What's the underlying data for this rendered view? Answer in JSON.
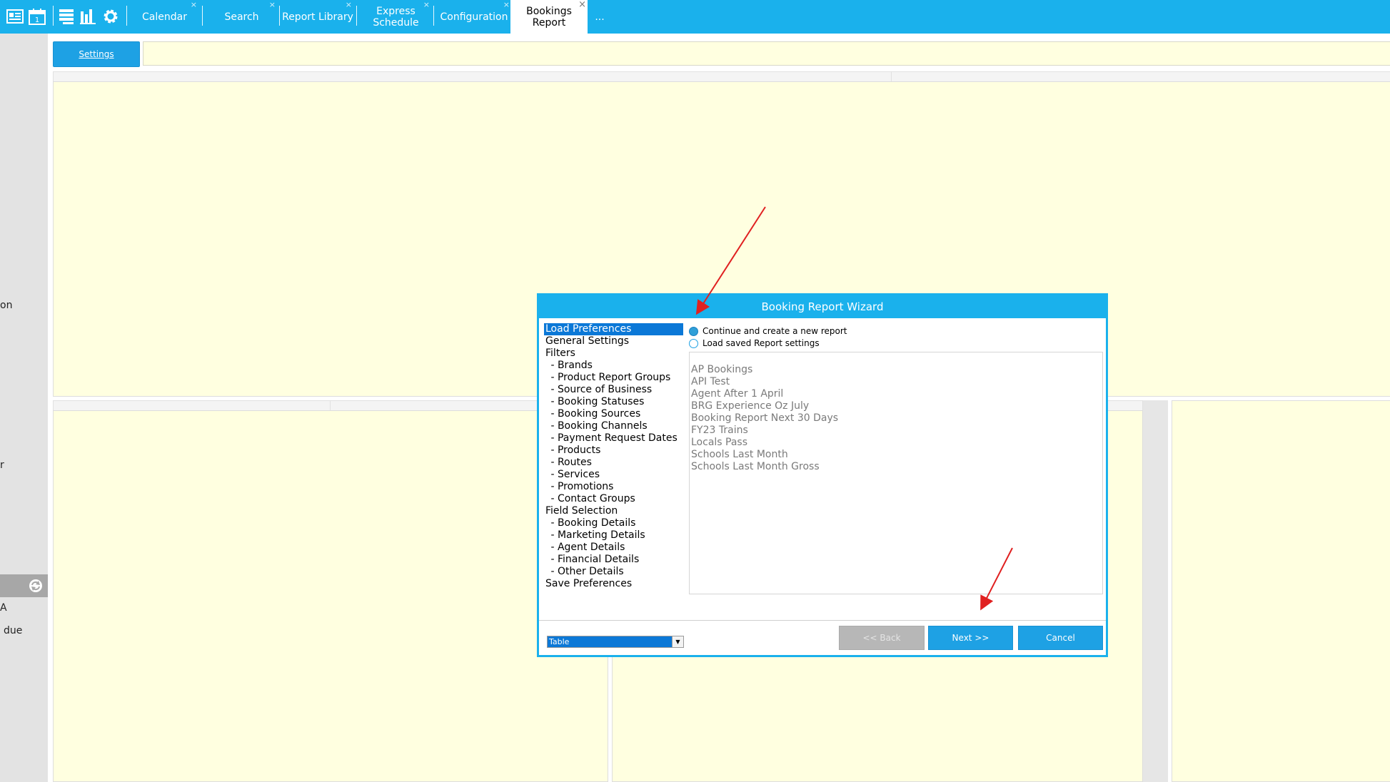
{
  "toolbar": {
    "icons": [
      "bookings-list-icon",
      "calendar-icon",
      "list-icon",
      "chart-icon",
      "gear-icon"
    ],
    "tabs": [
      {
        "label": "Calendar",
        "closable": true
      },
      {
        "label": "Search",
        "closable": true
      },
      {
        "label": "Report Library",
        "closable": true
      },
      {
        "label": "Express Schedule",
        "closable": true
      },
      {
        "label": "Configuration",
        "closable": true
      },
      {
        "label": "Bookings Report",
        "closable": true,
        "active": true
      }
    ],
    "overflow": "...",
    "close_glyph": "×",
    "accent_color": "#1ab1ec"
  },
  "left_strip": {
    "fragments": [
      "on",
      "r",
      "A",
      "due"
    ]
  },
  "main": {
    "settings_label": "Settings",
    "pane_color": "#ffffe0"
  },
  "dialog": {
    "title": "Booking Report Wizard",
    "steps": [
      {
        "label": "Load Preferences",
        "selected": true,
        "sub": false
      },
      {
        "label": "General Settings",
        "sub": false
      },
      {
        "label": "Filters",
        "sub": false
      },
      {
        "label": " - Brands",
        "sub": true
      },
      {
        "label": " - Product Report Groups",
        "sub": true
      },
      {
        "label": " - Source of Business",
        "sub": true
      },
      {
        "label": " - Booking Statuses",
        "sub": true
      },
      {
        "label": " - Booking Sources",
        "sub": true
      },
      {
        "label": " - Booking Channels",
        "sub": true
      },
      {
        "label": " - Payment Request Dates",
        "sub": true
      },
      {
        "label": " - Products",
        "sub": true
      },
      {
        "label": " - Routes",
        "sub": true
      },
      {
        "label": " - Services",
        "sub": true
      },
      {
        "label": " - Promotions",
        "sub": true
      },
      {
        "label": " - Contact Groups",
        "sub": true
      },
      {
        "label": "Field Selection",
        "sub": false
      },
      {
        "label": " - Booking Details",
        "sub": true
      },
      {
        "label": " - Marketing Details",
        "sub": true
      },
      {
        "label": " - Agent Details",
        "sub": true
      },
      {
        "label": " - Financial Details",
        "sub": true
      },
      {
        "label": " - Other Details",
        "sub": true
      },
      {
        "label": "Save Preferences",
        "sub": false
      }
    ],
    "options": {
      "new_report": "Continue and create a new report",
      "load_saved": "Load saved Report settings",
      "selected": "new_report"
    },
    "saved_reports": [
      "AP Bookings",
      "API Test",
      "Agent After 1 April",
      "BRG Experience Oz July",
      "Booking Report Next 30 Days",
      "FY23 Trains",
      "Locals Pass",
      "Schools Last Month",
      "Schools Last Month Gross"
    ],
    "view_select": "Table",
    "buttons": {
      "back": "<< Back",
      "next": "Next >>",
      "cancel": "Cancel"
    }
  },
  "annotation_color": "#e02020"
}
